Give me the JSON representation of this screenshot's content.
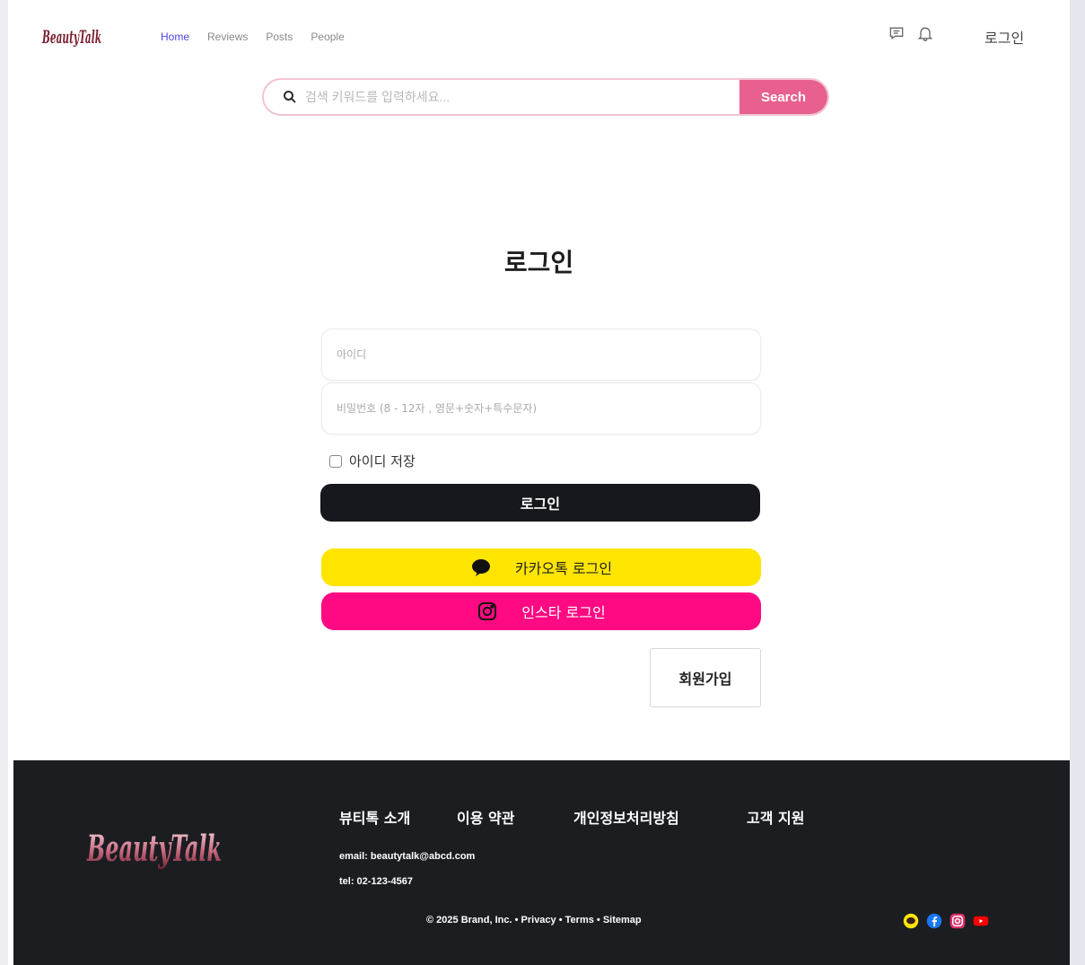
{
  "header": {
    "logo_text": "BeautyTalk",
    "nav": [
      "Home",
      "Reviews",
      "Posts",
      "People"
    ],
    "login_label": "로그인"
  },
  "search": {
    "placeholder": "검색 키워드를 입력하세요...",
    "button_label": "Search"
  },
  "login": {
    "title": "로그인",
    "id_placeholder": "아이디",
    "password_placeholder": "비밀번호 (8 - 12자 , 영문+숫자+특수문자)",
    "remember_label": "아이디 저장",
    "submit_label": "로그인",
    "kakao_label": "카카오톡 로그인",
    "insta_label": "인스타 로그인",
    "signup_label": "회원가입"
  },
  "footer": {
    "logo_text": "BeautyTalk",
    "links": [
      "뷰티톡 소개",
      "이용 약관",
      "개인정보처리방침",
      "고객 지원"
    ],
    "email": "email: beautytalk@abcd.com",
    "tel": "tel: 02-123-4567",
    "copyright": "© 2025 Brand, Inc.",
    "sep": "•",
    "legal_links": [
      "Privacy",
      "Terms",
      "Sitemap"
    ],
    "social": [
      "kakaotalk-icon",
      "facebook-icon",
      "instagram-icon",
      "youtube-icon"
    ]
  },
  "colors": {
    "accent": "#e8608f",
    "nav_active": "#4f46e5",
    "kakao": "#fee500",
    "insta": "#ff0a82",
    "dark": "#16181d",
    "footer_bg": "#1b1d21"
  }
}
